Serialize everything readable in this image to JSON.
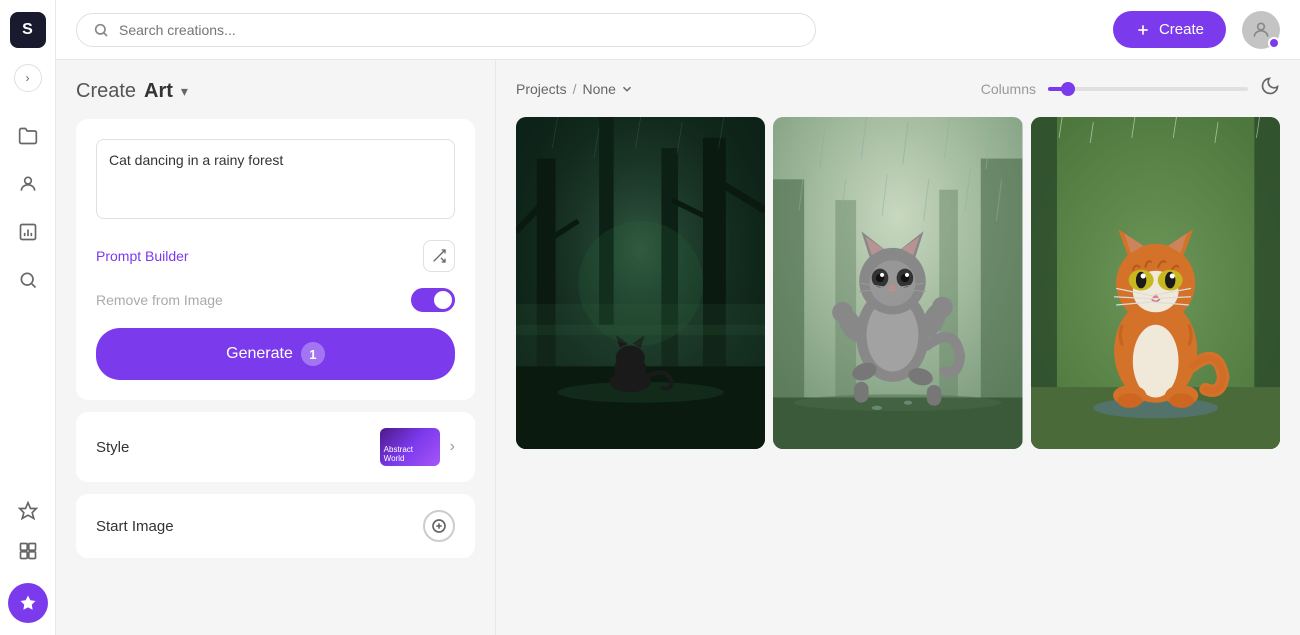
{
  "app": {
    "logo_text": "S",
    "toggle_icon": "›"
  },
  "topbar": {
    "search_placeholder": "Search creations...",
    "create_label": "Create",
    "create_icon": "+"
  },
  "sidebar": {
    "icons": [
      {
        "name": "folder-icon",
        "symbol": "📁",
        "active": false
      },
      {
        "name": "people-icon",
        "symbol": "👥",
        "active": false
      },
      {
        "name": "chart-icon",
        "symbol": "📊",
        "active": false
      },
      {
        "name": "search-icon",
        "symbol": "🔍",
        "active": false
      }
    ],
    "bottom_icon": {
      "name": "sparkle-icon",
      "symbol": "✨"
    }
  },
  "left_panel": {
    "title_prefix": "Create",
    "title_bold": "Art",
    "prompt_text": "Cat dancing in a rainy forest",
    "prompt_placeholder": "Cat dancing in a rainy forest",
    "prompt_builder_label": "Prompt Builder",
    "remove_image_label": "Remove from Image",
    "generate_label": "Generate",
    "generate_count": "1",
    "style_label": "Style",
    "style_preview_text": "Abstract World",
    "start_image_label": "Start Image"
  },
  "right_panel": {
    "breadcrumb_projects": "Projects",
    "breadcrumb_separator": "/",
    "breadcrumb_none": "None",
    "columns_label": "Columns",
    "columns_value": 3,
    "images": [
      {
        "id": "img1",
        "alt": "Cat in dark rainy forest - digital art"
      },
      {
        "id": "img2",
        "alt": "Anime cat dancing in rain"
      },
      {
        "id": "img3",
        "alt": "Real orange cat sitting in forest rain"
      }
    ]
  }
}
